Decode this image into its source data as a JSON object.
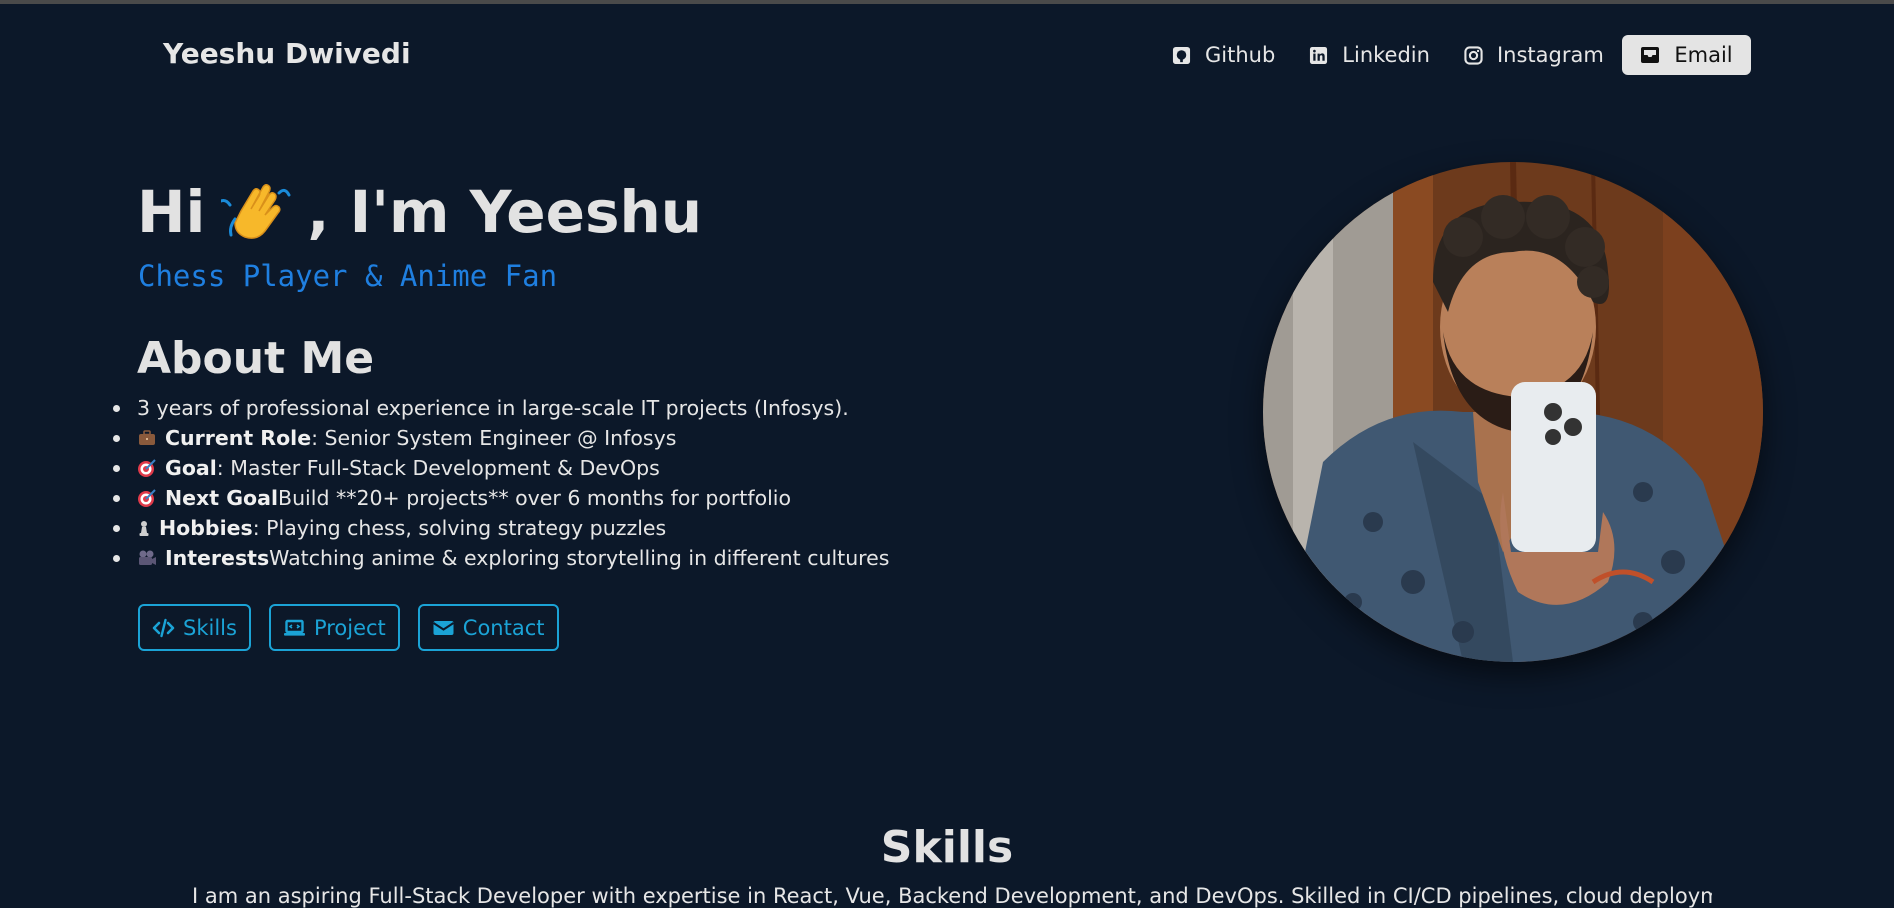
{
  "nav": {
    "brand": "Yeeshu Dwivedi",
    "links": [
      {
        "label": "Github",
        "icon": "github-icon"
      },
      {
        "label": "Linkedin",
        "icon": "linkedin-icon"
      },
      {
        "label": "Instagram",
        "icon": "instagram-icon"
      }
    ],
    "email_label": "Email",
    "email_icon": "inbox-icon"
  },
  "hero": {
    "greeting_pre": "Hi",
    "greeting_post": ", I'm Yeeshu",
    "subtitle": "Chess Player & Anime Fan"
  },
  "about": {
    "heading": "About Me",
    "items": [
      {
        "emoji": "",
        "bold": "",
        "text": "3 years of professional experience in large-scale IT projects (Infosys)."
      },
      {
        "emoji": "briefcase-icon",
        "bold": "Current Role",
        "text": ": Senior System Engineer @ Infosys"
      },
      {
        "emoji": "target-icon",
        "bold": "Goal",
        "text": ": Master Full-Stack Development & DevOps"
      },
      {
        "emoji": "target-icon",
        "bold": "Next Goal",
        "text": " Build **20+ projects** over 6 months for portfolio"
      },
      {
        "emoji": "chess-pawn-icon",
        "bold": "Hobbies",
        "text": ": Playing chess, solving strategy puzzles"
      },
      {
        "emoji": "film-camera-icon",
        "bold": "Interests",
        "text": " Watching anime & exploring storytelling in different cultures"
      }
    ]
  },
  "actions": {
    "skills_label": "Skills",
    "project_label": "Project",
    "contact_label": "Contact"
  },
  "skills": {
    "heading": "Skills",
    "intro": "I am an aspiring Full-Stack Developer with expertise in React, Vue, Backend Development, and DevOps. Skilled in CI/CD pipelines, cloud deployment, and"
  },
  "colors": {
    "background": "#0c1829",
    "accent": "#1ba3d6",
    "subtitle": "#1f7fe0"
  }
}
